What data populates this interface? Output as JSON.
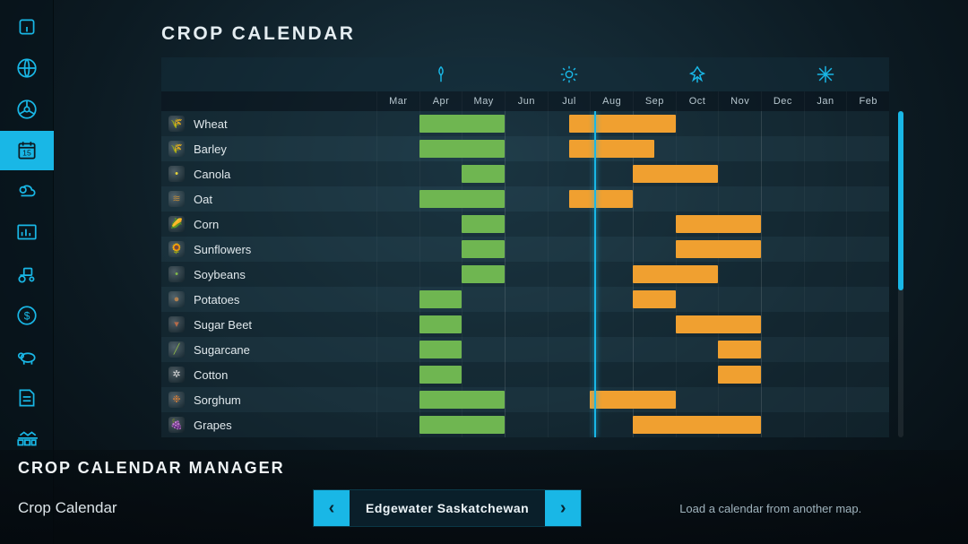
{
  "page_title": "CROP CALENDAR",
  "months": [
    "Mar",
    "Apr",
    "May",
    "Jun",
    "Jul",
    "Aug",
    "Sep",
    "Oct",
    "Nov",
    "Dec",
    "Jan",
    "Feb"
  ],
  "current_month_index": 5,
  "seasons": [
    "spring",
    "summer",
    "autumn",
    "winter"
  ],
  "crops": [
    {
      "name": "Wheat",
      "icon_color": "#c9a24a",
      "glyph": "🌾",
      "plant": [
        1.0,
        3.0
      ],
      "harvest": [
        4.5,
        7.0
      ]
    },
    {
      "name": "Barley",
      "icon_color": "#b8d25a",
      "glyph": "🌾",
      "plant": [
        1.0,
        3.0
      ],
      "harvest": [
        4.5,
        6.5
      ]
    },
    {
      "name": "Canola",
      "icon_color": "#e5d33a",
      "glyph": "•",
      "plant": [
        2.0,
        3.0
      ],
      "harvest": [
        6.0,
        8.0
      ]
    },
    {
      "name": "Oat",
      "icon_color": "#b8873a",
      "glyph": "≋",
      "plant": [
        1.0,
        3.0
      ],
      "harvest": [
        4.5,
        6.0
      ]
    },
    {
      "name": "Corn",
      "icon_color": "#e7c43a",
      "glyph": "🌽",
      "plant": [
        2.0,
        3.0
      ],
      "harvest": [
        7.0,
        9.0
      ]
    },
    {
      "name": "Sunflowers",
      "icon_color": "#e8a53a",
      "glyph": "🌻",
      "plant": [
        2.0,
        3.0
      ],
      "harvest": [
        7.0,
        9.0
      ]
    },
    {
      "name": "Soybeans",
      "icon_color": "#7fb84a",
      "glyph": "•",
      "plant": [
        2.0,
        3.0
      ],
      "harvest": [
        6.0,
        8.0
      ]
    },
    {
      "name": "Potatoes",
      "icon_color": "#b08050",
      "glyph": "●",
      "plant": [
        1.0,
        2.0
      ],
      "harvest": [
        6.0,
        7.0
      ]
    },
    {
      "name": "Sugar Beet",
      "icon_color": "#b56a4a",
      "glyph": "▾",
      "plant": [
        1.0,
        2.0
      ],
      "harvest": [
        7.0,
        9.0
      ]
    },
    {
      "name": "Sugarcane",
      "icon_color": "#8db84a",
      "glyph": "╱",
      "plant": [
        1.0,
        2.0
      ],
      "harvest": [
        8.0,
        9.0
      ]
    },
    {
      "name": "Cotton",
      "icon_color": "#d8d8d8",
      "glyph": "✲",
      "plant": [
        1.0,
        2.0
      ],
      "harvest": [
        8.0,
        9.0
      ]
    },
    {
      "name": "Sorghum",
      "icon_color": "#c97a3a",
      "glyph": "❉",
      "plant": [
        1.0,
        3.0
      ],
      "harvest": [
        5.0,
        7.0
      ]
    },
    {
      "name": "Grapes",
      "icon_color": "#9a5aa8",
      "glyph": "🍇",
      "plant": [
        1.0,
        3.0
      ],
      "harvest": [
        6.0,
        9.0
      ]
    }
  ],
  "footer": {
    "title": "CROP CALENDAR MANAGER",
    "label": "Crop Calendar",
    "selected": "Edgewater Saskatchewan",
    "hint": "Load a calendar from another map."
  },
  "sidebar": [
    "info",
    "globe",
    "steering",
    "calendar",
    "weather",
    "stats",
    "vehicles",
    "finance",
    "animals",
    "contracts",
    "production"
  ],
  "sidebar_active_index": 3
}
